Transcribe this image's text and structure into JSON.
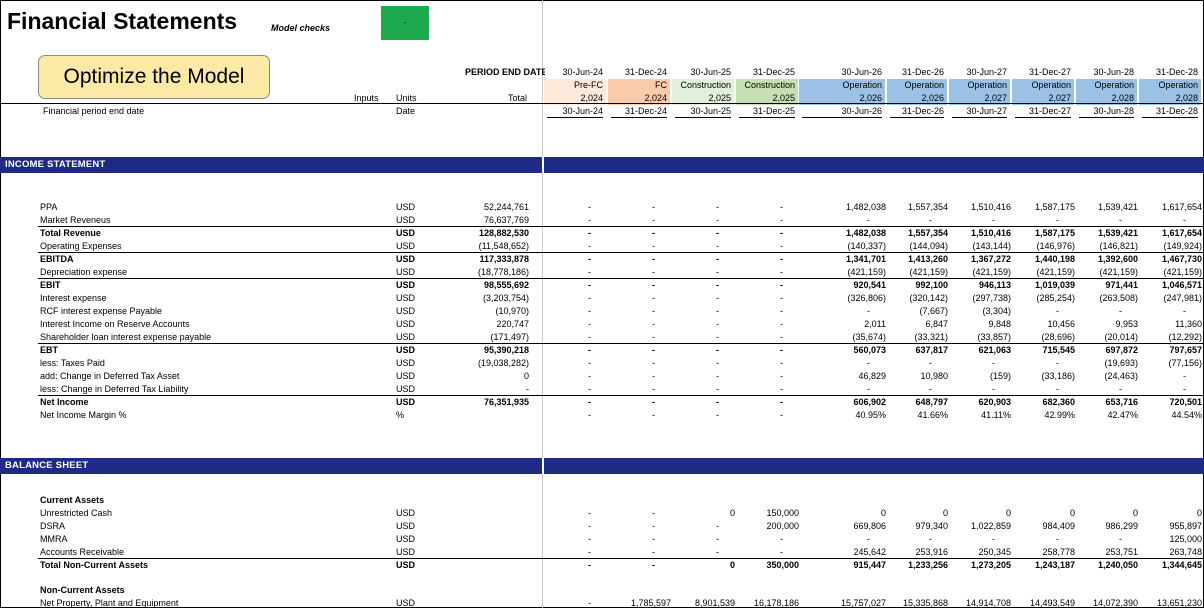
{
  "title": "Financial Statements",
  "model_checks": {
    "label": "Model checks",
    "value": "-",
    "color": "#1daa4e"
  },
  "optimize_button": "Optimize the Model",
  "header": {
    "period_end_label": "PERIOD END DATE",
    "inputs_label": "Inputs",
    "units_label": "Units",
    "total_label": "Total",
    "financial_period_label": "Financial period end date",
    "financial_period_unit": "Date",
    "periods": [
      {
        "date": "30-Jun-24",
        "phase": "Pre-FC",
        "year": "2,024",
        "end": "30-Jun-24",
        "color": "#fde9d9"
      },
      {
        "date": "31-Dec-24",
        "phase": "FC",
        "year": "2,024",
        "end": "31-Dec-24",
        "color": "#f8cbad"
      },
      {
        "date": "30-Jun-25",
        "phase": "Construction",
        "year": "2,025",
        "end": "30-Jun-25",
        "color": "#e2efda"
      },
      {
        "date": "31-Dec-25",
        "phase": "Construction",
        "year": "2,025",
        "end": "31-Dec-25",
        "color": "#c6e0b4"
      },
      {
        "date": "30-Jun-26",
        "phase": "Operation",
        "year": "2,026",
        "end": "30-Jun-26",
        "color": "#9bc2e6"
      },
      {
        "date": "31-Dec-26",
        "phase": "Operation",
        "year": "2,026",
        "end": "31-Dec-26",
        "color": "#9bc2e6"
      },
      {
        "date": "30-Jun-27",
        "phase": "Operation",
        "year": "2,027",
        "end": "30-Jun-27",
        "color": "#9bc2e6"
      },
      {
        "date": "31-Dec-27",
        "phase": "Operation",
        "year": "2,027",
        "end": "31-Dec-27",
        "color": "#9bc2e6"
      },
      {
        "date": "30-Jun-28",
        "phase": "Operation",
        "year": "2,028",
        "end": "30-Jun-28",
        "color": "#9bc2e6"
      },
      {
        "date": "31-Dec-28",
        "phase": "Operation",
        "year": "2,028",
        "end": "31-Dec-28",
        "color": "#9bc2e6"
      }
    ]
  },
  "income_statement": {
    "section_title": "INCOME STATEMENT",
    "rows": [
      {
        "label": "PPA",
        "unit": "USD",
        "total": "52,244,761",
        "values": [
          "-",
          "-",
          "-",
          "-",
          "1,482,038",
          "1,557,354",
          "1,510,416",
          "1,587,175",
          "1,539,421",
          "1,617,654"
        ]
      },
      {
        "label": "Market Reveneus",
        "unit": "USD",
        "total": "76,637,769",
        "values": [
          "-",
          "-",
          "-",
          "-",
          "-",
          "-",
          "-",
          "-",
          "-",
          "-"
        ]
      },
      {
        "label": "Total Revenue",
        "unit": "USD",
        "total": "128,882,530",
        "bold": true,
        "values": [
          "-",
          "-",
          "-",
          "-",
          "1,482,038",
          "1,557,354",
          "1,510,416",
          "1,587,175",
          "1,539,421",
          "1,617,654"
        ]
      },
      {
        "label": "Operating Expenses",
        "unit": "USD",
        "total": "(11,548,652)",
        "values": [
          "-",
          "-",
          "-",
          "-",
          "(140,337)",
          "(144,094)",
          "(143,144)",
          "(146,976)",
          "(146,821)",
          "(149,924)"
        ]
      },
      {
        "label": "EBITDA",
        "unit": "USD",
        "total": "117,333,878",
        "bold": true,
        "values": [
          "-",
          "-",
          "-",
          "-",
          "1,341,701",
          "1,413,260",
          "1,367,272",
          "1,440,198",
          "1,392,600",
          "1,467,730"
        ]
      },
      {
        "label": "Depreciation expense",
        "unit": "USD",
        "total": "(18,778,186)",
        "values": [
          "-",
          "-",
          "-",
          "-",
          "(421,159)",
          "(421,159)",
          "(421,159)",
          "(421,159)",
          "(421,159)",
          "(421,159)"
        ]
      },
      {
        "label": "EBIT",
        "unit": "USD",
        "total": "98,555,692",
        "bold": true,
        "values": [
          "-",
          "-",
          "-",
          "-",
          "920,541",
          "992,100",
          "946,113",
          "1,019,039",
          "971,441",
          "1,046,571"
        ]
      },
      {
        "label": "Interest expense",
        "unit": "USD",
        "total": "(3,203,754)",
        "values": [
          "-",
          "-",
          "-",
          "-",
          "(326,806)",
          "(320,142)",
          "(297,738)",
          "(285,254)",
          "(263,508)",
          "(247,981)"
        ]
      },
      {
        "label": "RCF interest expense Payable",
        "unit": "USD",
        "total": "(10,970)",
        "values": [
          "-",
          "-",
          "-",
          "-",
          "-",
          "(7,667)",
          "(3,304)",
          "-",
          "-",
          "-"
        ]
      },
      {
        "label": "Interest Income on Reserve Accounts",
        "unit": "USD",
        "total": "220,747",
        "values": [
          "-",
          "-",
          "-",
          "-",
          "2,011",
          "6,847",
          "9,848",
          "10,456",
          "9,953",
          "11,360"
        ]
      },
      {
        "label": "Shareholder loan interest expense payable",
        "unit": "USD",
        "total": "(171,497)",
        "values": [
          "-",
          "-",
          "-",
          "-",
          "(35,674)",
          "(33,321)",
          "(33,857)",
          "(28,696)",
          "(20,014)",
          "(12,292)"
        ]
      },
      {
        "label": "EBT",
        "unit": "USD",
        "total": "95,390,218",
        "bold": true,
        "values": [
          "-",
          "-",
          "-",
          "-",
          "560,073",
          "637,817",
          "621,063",
          "715,545",
          "697,872",
          "797,657"
        ]
      },
      {
        "label": "less: Taxes Paid",
        "unit": "USD",
        "total": "(19,038,282)",
        "values": [
          "-",
          "-",
          "-",
          "-",
          "-",
          "-",
          "-",
          "-",
          "(19,693)",
          "(77,156)"
        ]
      },
      {
        "label": "add: Change in Deferred Tax Asset",
        "unit": "USD",
        "total": "0",
        "values": [
          "-",
          "-",
          "-",
          "-",
          "46,829",
          "10,980",
          "(159)",
          "(33,186)",
          "(24,463)",
          "-"
        ]
      },
      {
        "label": "less: Change in Deferred Tax Liability",
        "unit": "USD",
        "total": "-",
        "values": [
          "-",
          "-",
          "-",
          "-",
          "-",
          "-",
          "-",
          "-",
          "-",
          "-"
        ]
      },
      {
        "label": "Net Income",
        "unit": "USD",
        "total": "76,351,935",
        "bold": true,
        "values": [
          "-",
          "-",
          "-",
          "-",
          "606,902",
          "648,797",
          "620,903",
          "682,360",
          "653,716",
          "720,501"
        ]
      },
      {
        "label": "Net Income Margin %",
        "unit": "%",
        "total": "",
        "values": [
          "-",
          "-",
          "-",
          "-",
          "40.95%",
          "41.66%",
          "41.11%",
          "42.99%",
          "42.47%",
          "44.54%"
        ]
      }
    ]
  },
  "balance_sheet": {
    "section_title": "BALANCE SHEET",
    "current_assets_title": "Current Assets",
    "rows": [
      {
        "label": "Unrestricted Cash",
        "unit": "USD",
        "total": "",
        "values": [
          "-",
          "-",
          "0",
          "150,000",
          "0",
          "0",
          "0",
          "0",
          "0",
          "0"
        ]
      },
      {
        "label": "DSRA",
        "unit": "USD",
        "total": "",
        "values": [
          "-",
          "-",
          "-",
          "200,000",
          "669,806",
          "979,340",
          "1,022,859",
          "984,409",
          "986,299",
          "955,897"
        ]
      },
      {
        "label": "MMRA",
        "unit": "USD",
        "total": "",
        "values": [
          "-",
          "-",
          "-",
          "-",
          "-",
          "-",
          "-",
          "-",
          "-",
          "125,000"
        ]
      },
      {
        "label": "Accounts Receivable",
        "unit": "USD",
        "total": "",
        "values": [
          "-",
          "-",
          "-",
          "-",
          "245,642",
          "253,916",
          "250,345",
          "258,778",
          "253,751",
          "263,748"
        ]
      },
      {
        "label": "Total Non-Current Assets",
        "unit": "USD",
        "total": "",
        "bold": true,
        "values": [
          "-",
          "-",
          "0",
          "350,000",
          "915,447",
          "1,233,256",
          "1,273,205",
          "1,243,187",
          "1,240,050",
          "1,344,645"
        ]
      }
    ],
    "non_current_title": "Non-Current Assets",
    "ppe_row": {
      "label": "Net Property, Plant and Equipment",
      "unit": "USD",
      "total": "",
      "values": [
        "-",
        "1,785,597",
        "8,901,539",
        "16,178,186",
        "15,757,027",
        "15,335,868",
        "14,914,708",
        "14,493,549",
        "14,072,390",
        "13,651,230"
      ]
    }
  },
  "colors": {
    "section_band": "#1f2a87"
  }
}
